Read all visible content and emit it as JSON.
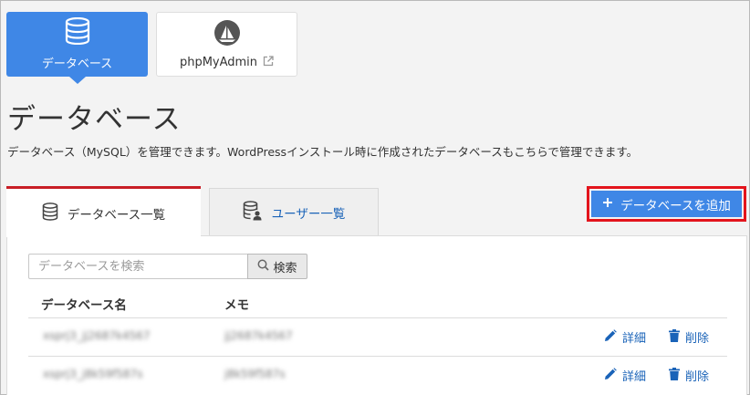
{
  "top_tiles": {
    "database": {
      "label": "データベース",
      "icon": "database-icon"
    },
    "phpmyadmin": {
      "label": "phpMyAdmin",
      "icon": "phpmyadmin-sailboat-icon",
      "external_icon": "external-link-icon"
    }
  },
  "page": {
    "title": "データベース",
    "description": "データベース（MySQL）を管理できます。WordPressインストール時に作成されたデータベースもこちらで管理できます。"
  },
  "tabs": [
    {
      "label": "データベース一覧",
      "icon": "database-icon",
      "active": true
    },
    {
      "label": "ユーザー一覧",
      "icon": "database-user-icon",
      "active": false
    }
  ],
  "add_button": {
    "label": "データベースを追加",
    "icon": "plus-icon"
  },
  "search": {
    "placeholder": "データベースを検索",
    "value": "",
    "button_label": "検索"
  },
  "table": {
    "headers": {
      "name": "データベース名",
      "memo": "メモ"
    },
    "rows": [
      {
        "name": "xsprj3_jj2687k4567",
        "memo": "jj2687k4567",
        "edit_label": "詳細",
        "delete_label": "削除"
      },
      {
        "name": "xsprj3_j8k59f587s",
        "memo": "j8k59f587s",
        "edit_label": "詳細",
        "delete_label": "削除"
      }
    ]
  },
  "colors": {
    "accent_blue": "#3f87e6",
    "link_blue": "#1a63b8",
    "active_tab_red": "#c81d25",
    "highlight_red": "#e3141c"
  }
}
